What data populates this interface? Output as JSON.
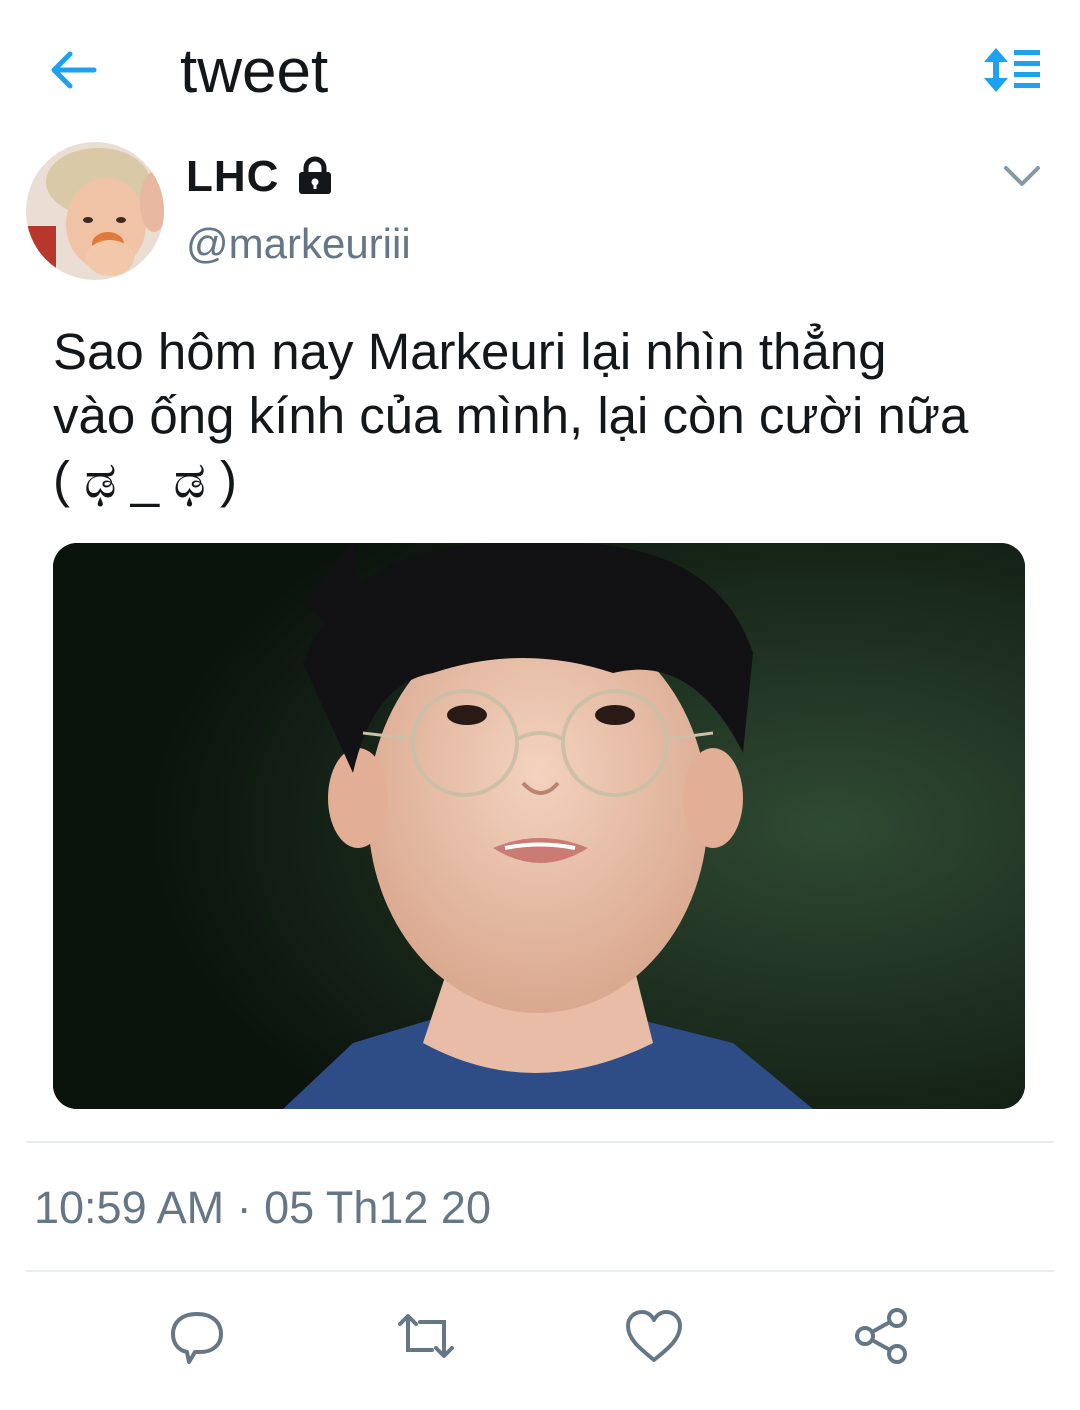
{
  "header": {
    "title": "tweet",
    "back_icon": "arrow-left-icon",
    "sort_icon": "sort-lines-icon",
    "accent_color": "#1da1f2"
  },
  "tweet": {
    "display_name": "LHC",
    "protected_icon": "lock-icon",
    "handle": "@markeuriii",
    "text": "Sao hôm nay Markeuri lại nhìn thẳng\nvào ống kính của mình, lại còn cười nữa\n( ಢ _ ಢ )",
    "timestamp": "10:59 AM · 05 Th12 20"
  },
  "actions": [
    {
      "name": "reply",
      "icon": "reply-bubble-icon"
    },
    {
      "name": "retweet",
      "icon": "retweet-icon"
    },
    {
      "name": "like",
      "icon": "heart-icon"
    },
    {
      "name": "share",
      "icon": "share-icon"
    }
  ],
  "colors": {
    "icon_gray": "#657786",
    "divider": "#e6ecf0",
    "text": "#14171a"
  }
}
